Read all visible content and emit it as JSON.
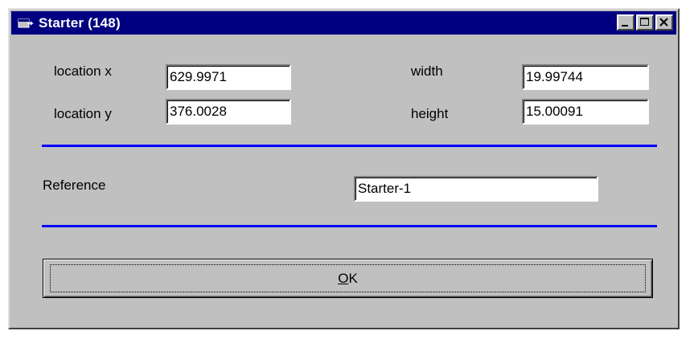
{
  "window": {
    "title": "Starter (148)",
    "title_bar_color": "#000080",
    "icon": "app-window-icon",
    "buttons": [
      "minimize-icon",
      "maximize-icon",
      "close-icon"
    ]
  },
  "form": {
    "location_x": {
      "label": "location x",
      "value": "629.9971"
    },
    "location_y": {
      "label": "location y",
      "value": "376.0028"
    },
    "width": {
      "label": "width",
      "value": "19.99744"
    },
    "height": {
      "label": "height",
      "value": "15.00091"
    },
    "reference": {
      "label": "Reference",
      "value": "Starter-1"
    }
  },
  "separator_color": "#0000ff",
  "ok_button": {
    "label_mnemonic": "O",
    "label_rest": "K"
  }
}
